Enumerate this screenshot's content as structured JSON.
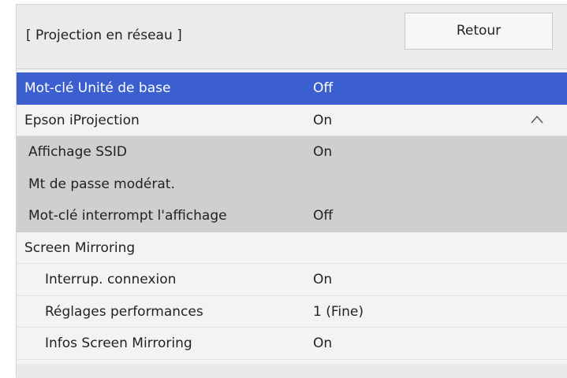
{
  "header": {
    "title": "[ Projection en réseau ]",
    "back_label": "Retour"
  },
  "menu": {
    "items": [
      {
        "label": "Mot-clé Unité de base",
        "value": "Off"
      },
      {
        "label": "Epson iProjection",
        "value": "On",
        "icon": "chevron-up-icon"
      },
      {
        "label": "Affichage SSID",
        "value": "On"
      },
      {
        "label": "Mt de passe modérat.",
        "value": ""
      },
      {
        "label": "Mot-clé interrompt l'affichage",
        "value": "Off"
      },
      {
        "label": "Screen Mirroring",
        "value": ""
      },
      {
        "label": "Interrup. connexion",
        "value": "On"
      },
      {
        "label": "Réglages performances",
        "value": "1 (Fine)"
      },
      {
        "label": "Infos Screen Mirroring",
        "value": "On"
      }
    ]
  },
  "colors": {
    "selection": "#3b5fcf",
    "submenu": "#cfcfcf",
    "background": "#f3f3f3"
  }
}
